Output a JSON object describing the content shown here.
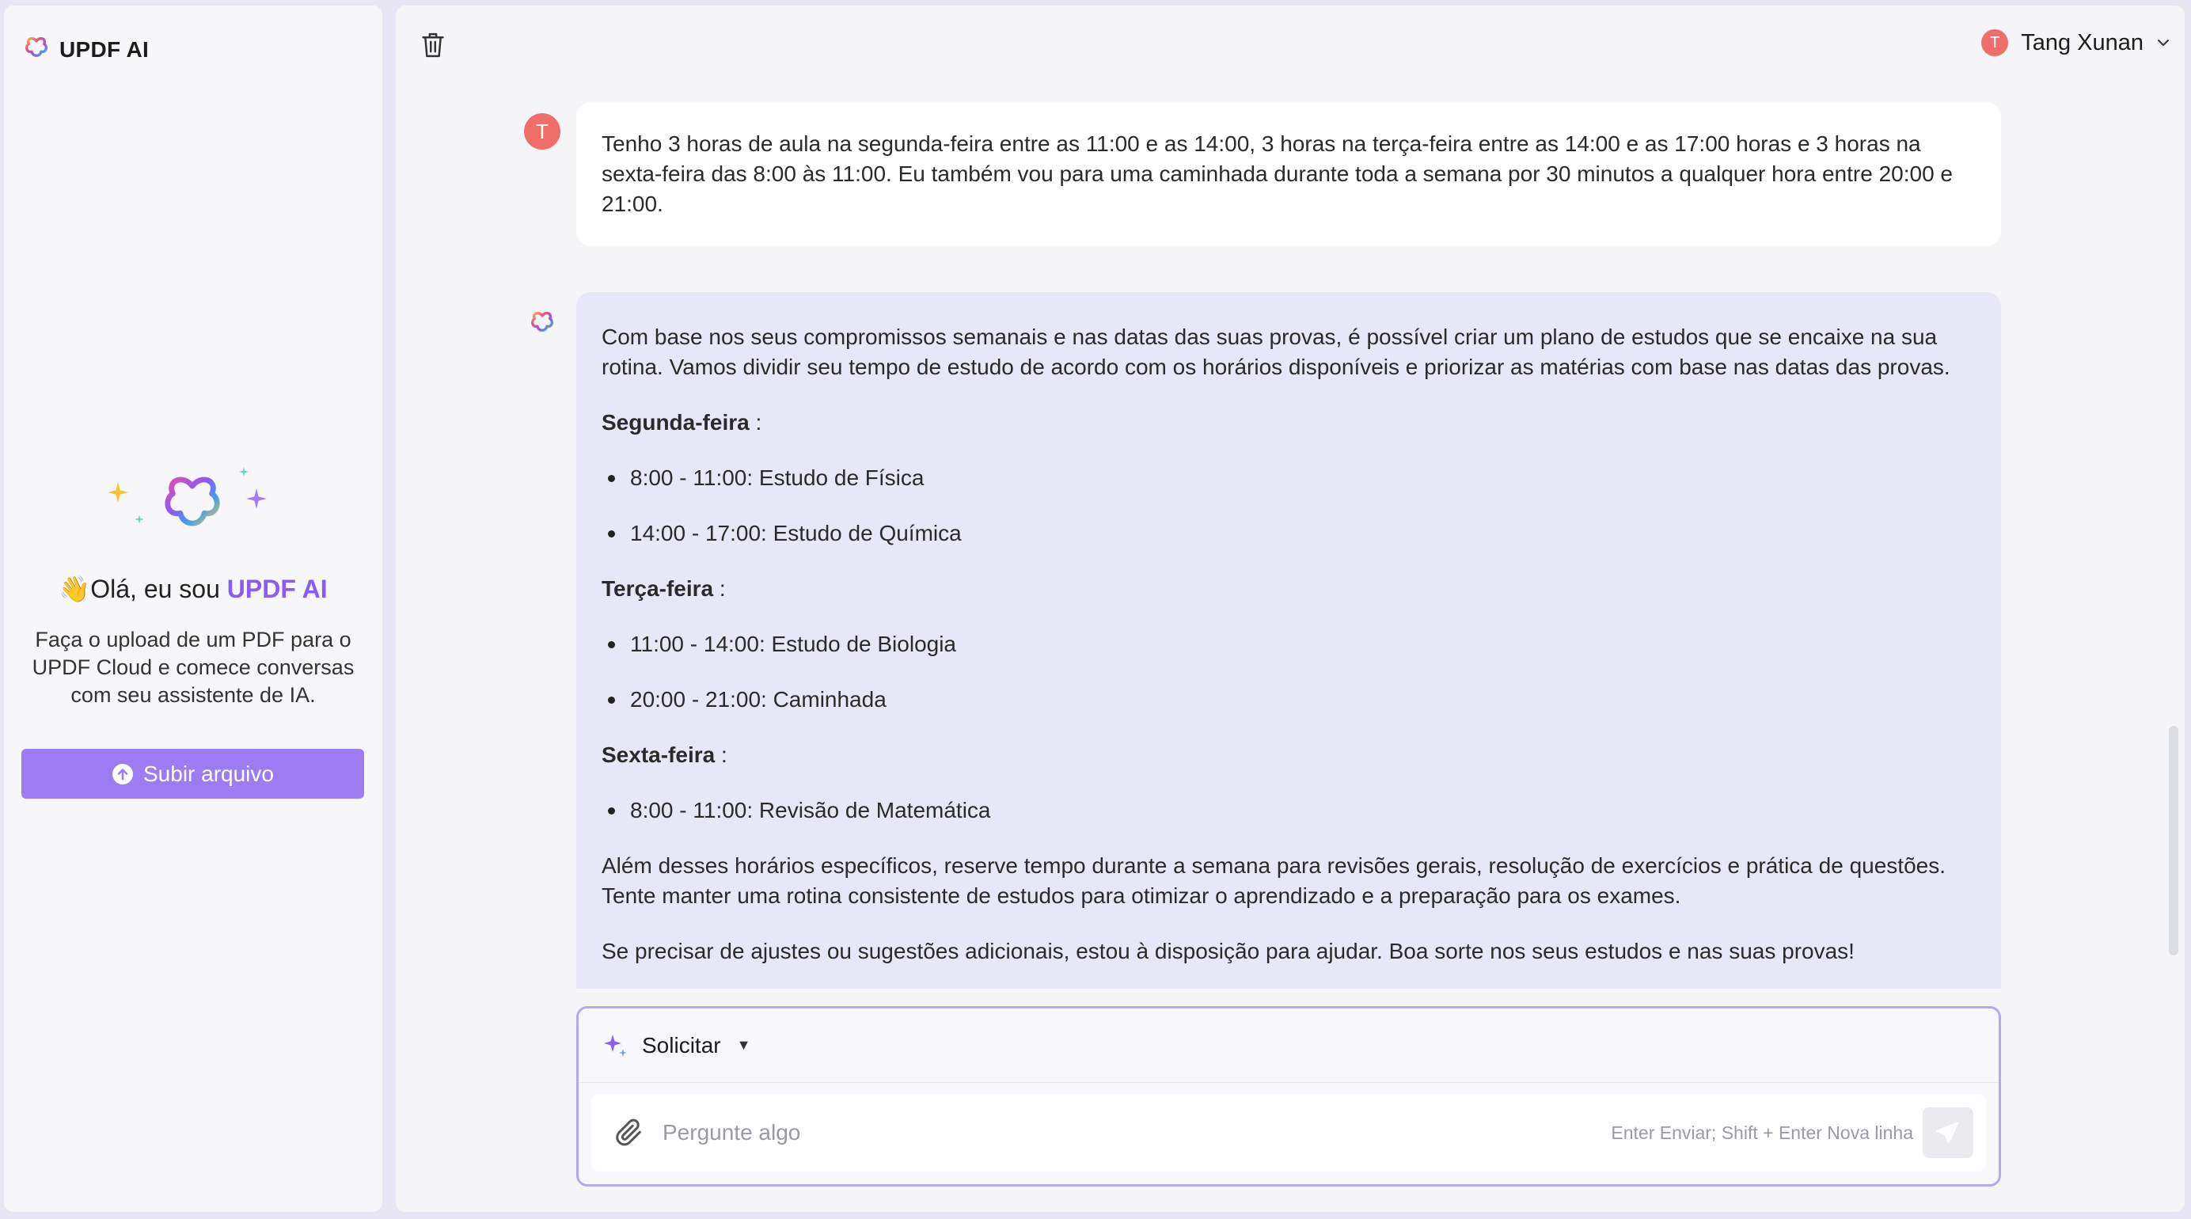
{
  "sidebar": {
    "brand": "UPDF AI",
    "greeting_emoji": "👋",
    "greeting_prefix": "Olá, eu sou ",
    "greeting_brand": "UPDF AI",
    "intro": "Faça o upload de um PDF para o UPDF Cloud e comece conversas com seu assistente de IA.",
    "upload_label": "Subir arquivo"
  },
  "header": {
    "user_initial": "T",
    "user_name": "Tang Xunan"
  },
  "chat": {
    "user_initial": "T",
    "user_message": "Tenho 3 horas de aula na segunda-feira entre as 11:00 e as 14:00, 3 horas na terça-feira entre as 14:00 e as 17:00 horas e 3 horas na sexta-feira das 8:00 às 11:00. Eu também vou para uma caminhada durante toda a semana por 30 minutos a qualquer hora entre 20:00 e 21:00.",
    "ai_intro": "Com base nos seus compromissos semanais e nas datas das suas provas, é possível criar um plano de estudos que se encaixe na sua rotina. Vamos dividir seu tempo de estudo de acordo com os horários disponíveis e priorizar as matérias com base nas datas das provas.",
    "days": [
      {
        "name": "Segunda-feira",
        "items": [
          "8:00 - 11:00: Estudo de Física",
          "14:00 - 17:00: Estudo de Química"
        ]
      },
      {
        "name": "Terça-feira",
        "items": [
          "11:00 - 14:00: Estudo de Biologia",
          "20:00 - 21:00: Caminhada"
        ]
      },
      {
        "name": "Sexta-feira",
        "items": [
          "8:00 - 11:00: Revisão de Matemática"
        ]
      }
    ],
    "day_suffix": " :",
    "ai_outro": "Além desses horários específicos, reserve tempo durante a semana para revisões gerais, resolução de exercícios e prática de questões. Tente manter uma rotina consistente de estudos para otimizar o aprendizado e a preparação para os exames.",
    "ai_closing": "Se precisar de ajustes ou sugestões adicionais, estou à disposição para ajudar. Boa sorte nos seus estudos e nas suas provas!"
  },
  "composer": {
    "prompt_label": "Solicitar",
    "placeholder": "Pergunte algo",
    "hint": "Enter Enviar; Shift + Enter Nova linha"
  },
  "colors": {
    "accent": "#9d7cf3",
    "user_avatar": "#ef6e6a",
    "ai_bubble": "#e8e7f7"
  }
}
